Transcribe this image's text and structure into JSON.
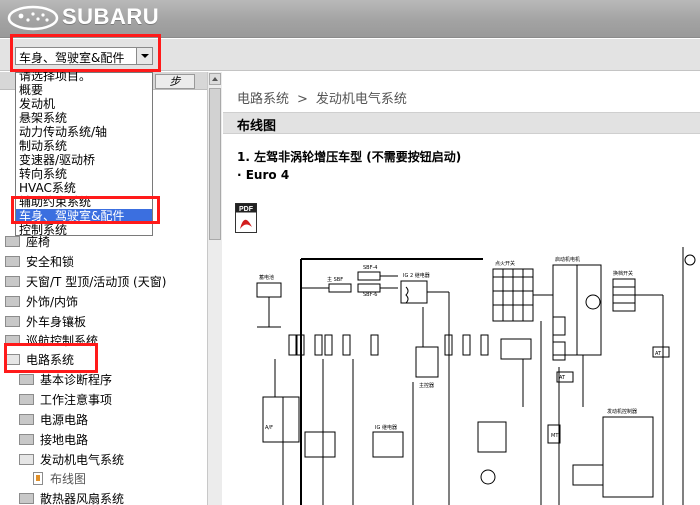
{
  "header": {
    "brand": "SUBARU"
  },
  "toolbar": {
    "selected_value": "车身、驾驶室&配件"
  },
  "dropdown": {
    "items": [
      "请选择项目。",
      "概要",
      "发动机",
      "悬架系统",
      "动力传动系统/轴",
      "制动系统",
      "变速器/驱动桥",
      "转向系统",
      "HVAC系统",
      "辅助约束系统",
      "车身、驾驶室&配件",
      "控制系统"
    ]
  },
  "left_panel": {
    "step_button": "步",
    "tree": [
      "座椅",
      "安全和锁",
      "天窗/T 型顶/活动顶 (天窗)",
      "外饰/内饰",
      "外车身镶板",
      "巡航控制系统",
      "电路系统",
      "基本诊断程序",
      "工作注意事项",
      "电源电路",
      "接地电路",
      "发动机电气系统",
      "布线图",
      "散热器风扇系统"
    ]
  },
  "content": {
    "breadcrumb": [
      "电路系统",
      "发动机电气系统"
    ],
    "breadcrumb_sep": ">",
    "section_title": "布线图",
    "heading": "1. 左驾非涡轮增压车型 (不需要按钮启动)",
    "bullet": "· Euro 4",
    "pdf_label": "PDF"
  },
  "diagram": {
    "labels": {
      "fuse_sbf4": "SBF-4",
      "fuse_sbf6": "SBF-6",
      "main_sbf": "主 SBF",
      "ig2": "IG 2 继电器",
      "battery": "蓄电池",
      "ig_switch": "点火开关",
      "generator": "启动机电机",
      "gear_switch": "换档开关",
      "ig_relay": "IG 继电器",
      "main_relay": "主控器",
      "at": "AT",
      "af": "A/F",
      "mt": "MT",
      "eng_ctrl": "发动机控制器"
    },
    "colors": {
      "line": "#000000",
      "box": "#000000"
    }
  }
}
